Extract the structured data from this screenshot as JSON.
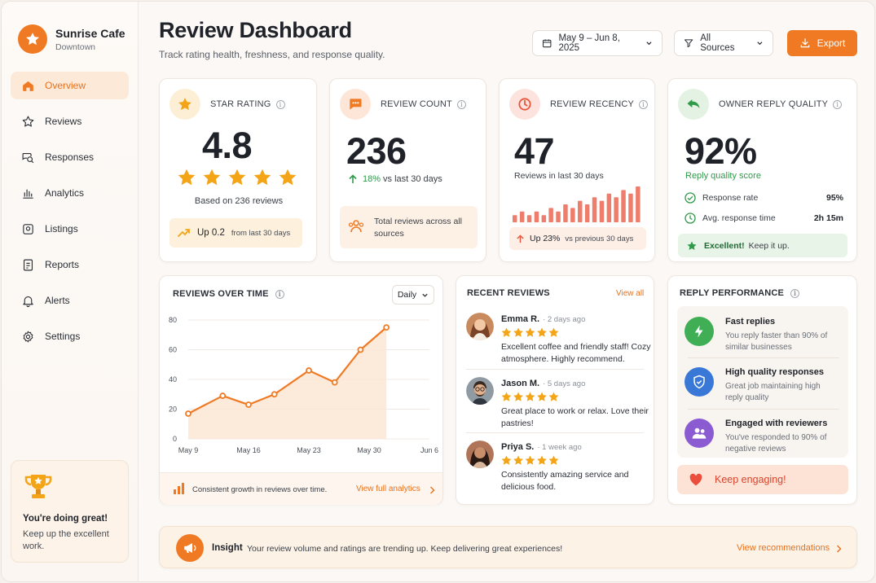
{
  "brand": {
    "name": "Sunrise Cafe",
    "location": "Downtown"
  },
  "nav": [
    {
      "label": "Overview",
      "icon": "home-icon"
    },
    {
      "label": "Reviews",
      "icon": "star-icon"
    },
    {
      "label": "Responses",
      "icon": "chat-search-icon"
    },
    {
      "label": "Analytics",
      "icon": "bar-chart-icon"
    },
    {
      "label": "Listings",
      "icon": "store-icon"
    },
    {
      "label": "Reports",
      "icon": "report-icon"
    },
    {
      "label": "Alerts",
      "icon": "bell-icon"
    },
    {
      "label": "Settings",
      "icon": "gear-icon"
    }
  ],
  "promo": {
    "title": "You're doing great!",
    "text": "Keep up the excellent work."
  },
  "header": {
    "title": "Review Dashboard",
    "subtitle": "Track rating health, freshness, and response quality.",
    "date_range": "May 9 – Jun 8, 2025",
    "source_filter": "All Sources",
    "export_label": "Export"
  },
  "colors": {
    "accent": "#f07a24",
    "green": "#2f9a4a",
    "red_bar": "#ee7d6c"
  },
  "star_rating": {
    "label": "STAR RATING",
    "value": "4.8",
    "based_on": "Based on 236 reviews",
    "stars": 5,
    "trend_up": "Up 0.2",
    "trend_note": "from last 30 days"
  },
  "review_count": {
    "label": "REVIEW COUNT",
    "value": "236",
    "change": "18%",
    "change_note": "vs last 30 days",
    "footer": "Total reviews across all sources"
  },
  "review_recency": {
    "label": "REVIEW RECENCY",
    "value": "47",
    "sub": "Reviews in last 30 days",
    "bars": [
      2,
      3,
      2,
      3,
      2,
      4,
      3,
      5,
      4,
      6,
      5,
      7,
      6,
      8,
      7,
      9,
      8,
      10
    ],
    "change": "Up 23%",
    "change_note": "vs previous 30 days"
  },
  "reply_quality": {
    "label": "OWNER REPLY QUALITY",
    "value": "92%",
    "caption": "Reply quality score",
    "rows": [
      {
        "label": "Response rate",
        "value": "95%"
      },
      {
        "label": "Avg. response time",
        "value": "2h 15m"
      }
    ],
    "badge_strong": "Excellent!",
    "badge_text": "Keep it up."
  },
  "reviews_over_time": {
    "title": "REVIEWS OVER TIME",
    "granularity": "Daily",
    "footer": "Consistent growth in reviews over time.",
    "link": "View full analytics"
  },
  "chart_data": {
    "type": "area",
    "title": "REVIEWS OVER TIME",
    "x_tick_labels": [
      "May 9",
      "May 16",
      "May 23",
      "May 30",
      "Jun 6"
    ],
    "x": [
      0,
      5,
      10,
      15,
      20,
      25,
      30,
      32,
      35
    ],
    "values": [
      17,
      29,
      23,
      30,
      46,
      38,
      60,
      75
    ],
    "ylim": [
      0,
      80
    ],
    "y_ticks": [
      0,
      20,
      40,
      60,
      80
    ],
    "grid": true
  },
  "recent_reviews": {
    "title": "RECENT REVIEWS",
    "link": "View all",
    "items": [
      {
        "name": "Emma R.",
        "time": "· 2 days ago",
        "text": "Excellent coffee and friendly staff! Cozy atmosphere. Highly recommend."
      },
      {
        "name": "Jason M.",
        "time": "· 5 days ago",
        "text": "Great place to work or relax. Love their pastries!"
      },
      {
        "name": "Priya S.",
        "time": "· 1 week ago",
        "text": "Consistently amazing service and delicious food."
      }
    ]
  },
  "reply_performance": {
    "title": "REPLY PERFORMANCE",
    "items": [
      {
        "title": "Fast replies",
        "text": "You reply faster than 90% of similar businesses"
      },
      {
        "title": "High quality responses",
        "text": "Great job maintaining high reply quality"
      },
      {
        "title": "Engaged with reviewers",
        "text": "You've responded to 90% of negative reviews"
      }
    ],
    "cta": "Keep engaging!"
  },
  "insight": {
    "label": "Insight",
    "text": "Your review volume and ratings are trending up. Keep delivering great experiences!",
    "link": "View recommendations"
  }
}
